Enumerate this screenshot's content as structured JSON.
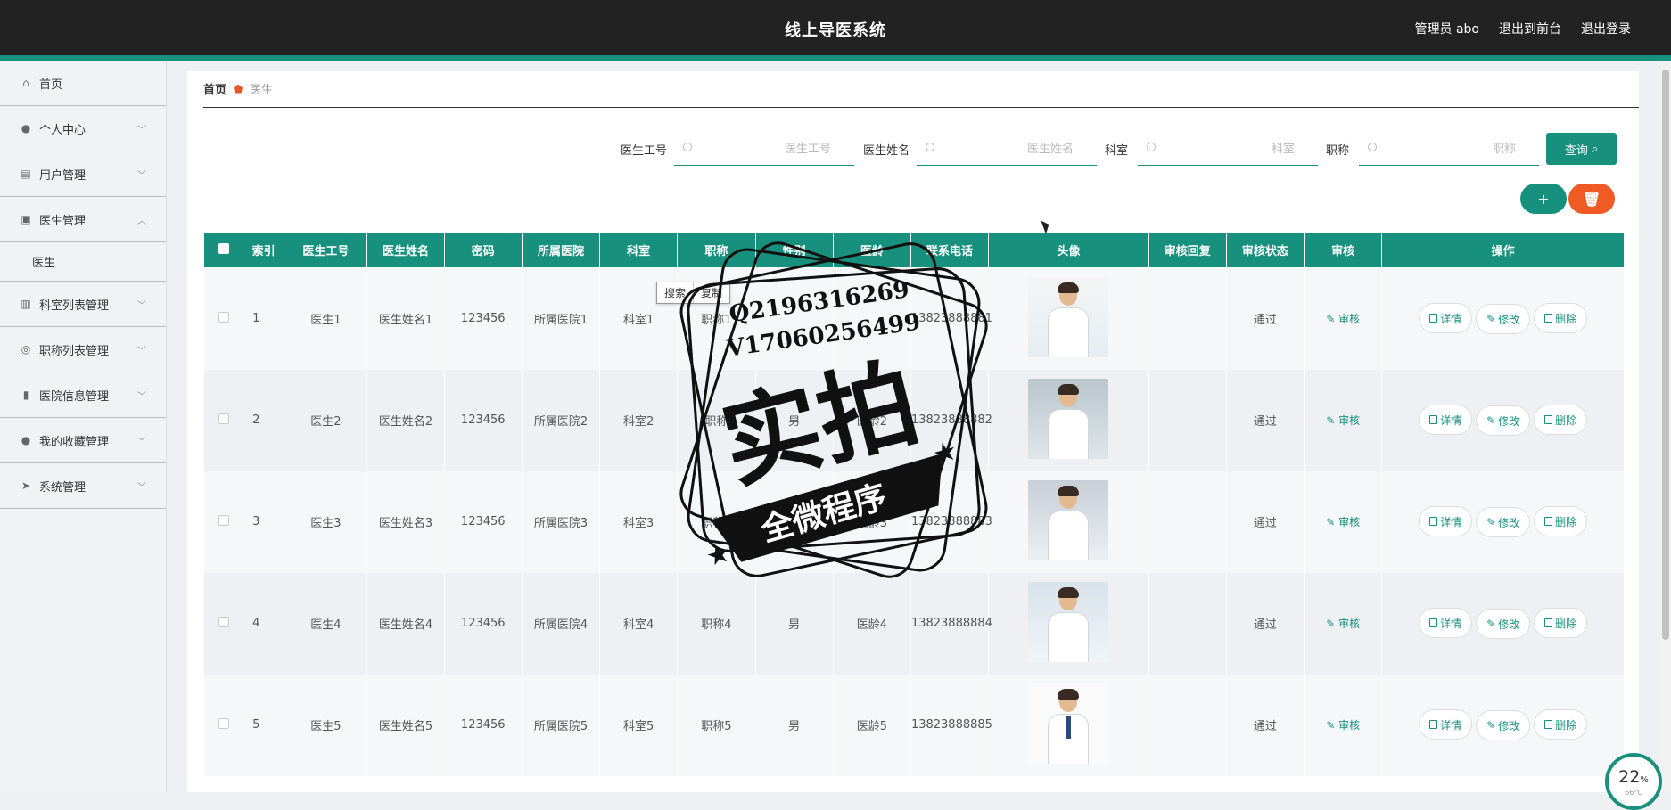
{
  "header": {
    "title": "线上导医系统",
    "admin": "管理员 abo",
    "to_front": "退出到前台",
    "logout": "退出登录"
  },
  "sidebar": {
    "items": [
      {
        "label": "首页",
        "icon": "home-icon"
      },
      {
        "label": "个人中心",
        "icon": "user-icon"
      },
      {
        "label": "用户管理",
        "icon": "chart-icon"
      },
      {
        "label": "医生管理",
        "icon": "clipboard-icon",
        "expanded": true,
        "sub": [
          "医生"
        ]
      },
      {
        "label": "科室列表管理",
        "icon": "bar-icon"
      },
      {
        "label": "职称列表管理",
        "icon": "compass-icon"
      },
      {
        "label": "医院信息管理",
        "icon": "stats-icon"
      },
      {
        "label": "我的收藏管理",
        "icon": "pin-icon"
      },
      {
        "label": "系统管理",
        "icon": "send-icon"
      }
    ]
  },
  "breadcrumb": {
    "home": "首页",
    "current": "医生"
  },
  "search": {
    "doc_no_label": "医生工号",
    "doc_no_placeholder": "医生工号",
    "doc_name_label": "医生姓名",
    "doc_name_placeholder": "医生姓名",
    "dept_label": "科室",
    "dept_placeholder": "科室",
    "title_label": "职称",
    "title_placeholder": "职称",
    "query_label": "查询"
  },
  "actions": {
    "add": "+",
    "delete": "🗑"
  },
  "table": {
    "headers": [
      "索引",
      "医生工号",
      "医生姓名",
      "密码",
      "所属医院",
      "科室",
      "职称",
      "性别",
      "医龄",
      "联系电话",
      "头像",
      "审核回复",
      "审核状态",
      "审核",
      "操作"
    ],
    "rows": [
      {
        "idx": "1",
        "no": "医生1",
        "name": "医生姓名1",
        "pwd": "123456",
        "hospital": "所属医院1",
        "dept": "科室1",
        "title": "职称1",
        "sex": "",
        "age": "",
        "phone": "13823888881",
        "reply": "",
        "status": "通过"
      },
      {
        "idx": "2",
        "no": "医生2",
        "name": "医生姓名2",
        "pwd": "123456",
        "hospital": "所属医院2",
        "dept": "科室2",
        "title": "职称",
        "sex": "男",
        "age": "医龄2",
        "phone": "13823888882",
        "reply": "",
        "status": "通过"
      },
      {
        "idx": "3",
        "no": "医生3",
        "name": "医生姓名3",
        "pwd": "123456",
        "hospital": "所属医院3",
        "dept": "科室3",
        "title": "职称3",
        "sex": "",
        "age": "医龄3",
        "phone": "13823888883",
        "reply": "",
        "status": "通过"
      },
      {
        "idx": "4",
        "no": "医生4",
        "name": "医生姓名4",
        "pwd": "123456",
        "hospital": "所属医院4",
        "dept": "科室4",
        "title": "职称4",
        "sex": "男",
        "age": "医龄4",
        "phone": "13823888884",
        "reply": "",
        "status": "通过"
      },
      {
        "idx": "5",
        "no": "医生5",
        "name": "医生姓名5",
        "pwd": "123456",
        "hospital": "所属医院5",
        "dept": "科室5",
        "title": "职称5",
        "sex": "男",
        "age": "医龄5",
        "phone": "13823888885",
        "reply": "",
        "status": "通过"
      }
    ],
    "audit_label": "审核",
    "detail_label": "详情",
    "edit_label": "修改",
    "remove_label": "删除"
  },
  "context_menu": {
    "search": "搜索",
    "copy": "复制"
  },
  "watermark": {
    "line1": "Q2196316269",
    "line2": "V17060256499",
    "big": "实拍",
    "banner": "全微程序"
  },
  "gauge": {
    "percent": "22",
    "unit": "%",
    "temp": "66°C"
  },
  "colors": {
    "accent": "#17917e",
    "danger": "#f05a24",
    "header_bg": "#222222"
  }
}
